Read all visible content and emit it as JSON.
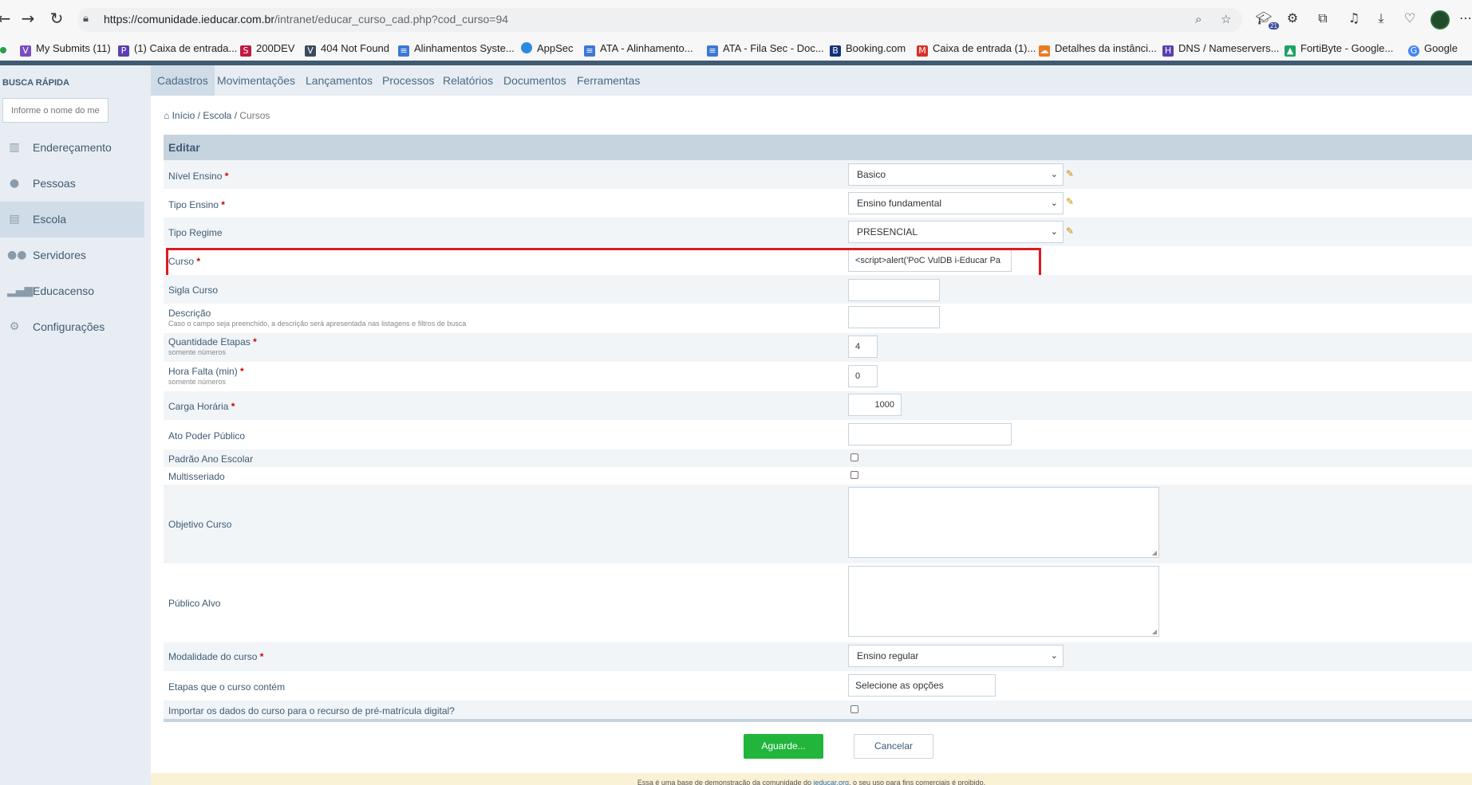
{
  "browser": {
    "url_host": "https://comunidade.ieducar.com.br",
    "url_path": "/intranet/educar_curso_cad.php?cod_curso=94",
    "extension_badge": "21",
    "bookmarks": [
      {
        "label": "My Submits (11)",
        "icon": "vulnerability-icon",
        "color": "#7b4bc2"
      },
      {
        "label": "(1) Caixa de entrada...",
        "icon": "p-icon",
        "color": "#5b3fb0"
      },
      {
        "label": "200DEV",
        "icon": "s-icon",
        "color": "#c0183f"
      },
      {
        "label": "404 Not Found",
        "icon": "v-icon",
        "color": "#3c4a5c"
      },
      {
        "label": "Alinhamentos Syste...",
        "icon": "doc-icon",
        "color": "#3c78d8"
      },
      {
        "label": "AppSec",
        "icon": "drop-icon",
        "color": "#2b8be0"
      },
      {
        "label": "ATA - Alinhamento...",
        "icon": "doc-icon",
        "color": "#3c78d8"
      },
      {
        "label": "ATA - Fila Sec - Doc...",
        "icon": "doc-icon",
        "color": "#3c78d8"
      },
      {
        "label": "Booking.com",
        "icon": "b-icon",
        "color": "#12317d"
      },
      {
        "label": "Caixa de entrada (1)...",
        "icon": "gmail-icon",
        "color": "#d93025"
      },
      {
        "label": "Detalhes da instânci...",
        "icon": "cloud-icon",
        "color": "#e97b22"
      },
      {
        "label": "DNS / Nameservers...",
        "icon": "h-icon",
        "color": "#5a3fb0"
      },
      {
        "label": "FortiByte - Google...",
        "icon": "drive-icon",
        "color": "#1ea362"
      },
      {
        "label": "Google",
        "icon": "google-icon",
        "color": "#4285f4"
      }
    ]
  },
  "sidebar": {
    "title": "BUSCA RÁPIDA",
    "search_placeholder": "Informe o nome do menu",
    "items": [
      {
        "label": "Endereçamento",
        "icon": "map-icon"
      },
      {
        "label": "Pessoas",
        "icon": "user-icon"
      },
      {
        "label": "Escola",
        "icon": "book-icon"
      },
      {
        "label": "Servidores",
        "icon": "users-icon"
      },
      {
        "label": "Educacenso",
        "icon": "bar-chart-icon"
      },
      {
        "label": "Configurações",
        "icon": "gear-icon"
      }
    ]
  },
  "topmenu": [
    "Cadastros",
    "Movimentações",
    "Lançamentos",
    "Processos",
    "Relatórios",
    "Documentos",
    "Ferramentas"
  ],
  "breadcrumb": {
    "home": "Início",
    "sep1": "/",
    "school": "Escola",
    "sep2": "/",
    "current": "Cursos"
  },
  "form": {
    "title": "Editar",
    "nivel_ensino": {
      "label": "Nível Ensino",
      "value": "Basico"
    },
    "tipo_ensino": {
      "label": "Tipo Ensino",
      "value": "Ensino fundamental"
    },
    "tipo_regime": {
      "label": "Tipo Regime",
      "value": "PRESENCIAL"
    },
    "curso": {
      "label": "Curso",
      "value": "<script>alert('PoC VulDB i-Educar Pa"
    },
    "sigla": {
      "label": "Sigla Curso",
      "value": ""
    },
    "descricao": {
      "label": "Descrição",
      "hint": "Caso o campo seja preenchido, a descrição será apresentada nas listagens e filtros de busca",
      "value": ""
    },
    "qtd_etapas": {
      "label": "Quantidade Etapas",
      "hint": "somente números",
      "value": "4"
    },
    "hora_falta": {
      "label": "Hora Falta (min)",
      "hint": "somente números",
      "value": "0"
    },
    "carga_horaria": {
      "label": "Carga Horária",
      "value": "1000"
    },
    "ato_poder": {
      "label": "Ato Poder Público",
      "value": ""
    },
    "padrao_ano": {
      "label": "Padrão Ano Escolar",
      "checked": false
    },
    "multisseriado": {
      "label": "Multisseriado",
      "checked": false
    },
    "objetivo": {
      "label": "Objetivo Curso",
      "value": ""
    },
    "publico": {
      "label": "Público Alvo",
      "value": ""
    },
    "modalidade": {
      "label": "Modalidade do curso",
      "value": "Ensino regular"
    },
    "etapas": {
      "label": "Etapas que o curso contém",
      "value": "Selecione as opções"
    },
    "importar": {
      "label": "Importar os dados do curso para o recurso de pré-matrícula digital?",
      "checked": false
    },
    "required_mark": "*"
  },
  "buttons": {
    "save": "Aguarde...",
    "cancel": "Cancelar"
  },
  "footer": {
    "text_before": "Essa é uma base de demonstração da comunidade do ",
    "link": "ieducar.org",
    "text_after": ", o seu uso para fins comerciais é proibido."
  },
  "colors": {
    "accent": "#3f5a72",
    "save": "#21b53c",
    "highlight": "#e0191f",
    "required": "#cc0000"
  }
}
